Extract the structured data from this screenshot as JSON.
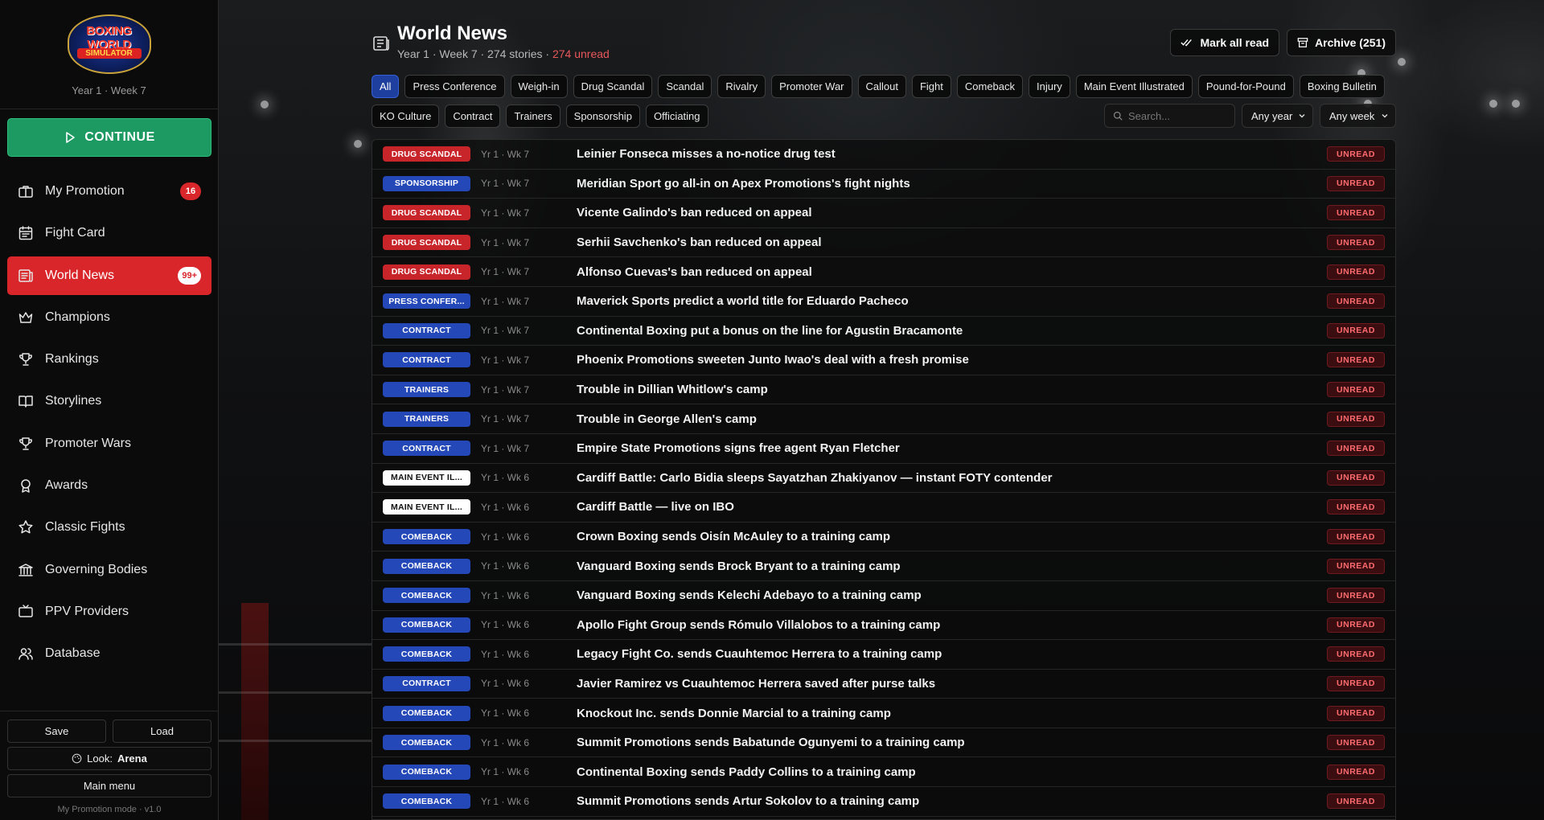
{
  "app": {
    "logo_line1": "BOXING WORLD",
    "logo_line2": "SIMULATOR",
    "period": "Year 1 · Week 7"
  },
  "sidebar": {
    "continue_label": "CONTINUE",
    "items": [
      {
        "label": "My Promotion",
        "icon": "briefcase-icon",
        "badge": "16",
        "active": false
      },
      {
        "label": "Fight Card",
        "icon": "calendar-icon",
        "badge": "",
        "active": false
      },
      {
        "label": "World News",
        "icon": "newspaper-icon",
        "badge": "99+",
        "active": true
      },
      {
        "label": "Champions",
        "icon": "crown-icon",
        "badge": "",
        "active": false
      },
      {
        "label": "Rankings",
        "icon": "trophy-icon",
        "badge": "",
        "active": false
      },
      {
        "label": "Storylines",
        "icon": "book-icon",
        "badge": "",
        "active": false
      },
      {
        "label": "Promoter Wars",
        "icon": "trophy-icon",
        "badge": "",
        "active": false
      },
      {
        "label": "Awards",
        "icon": "award-icon",
        "badge": "",
        "active": false
      },
      {
        "label": "Classic Fights",
        "icon": "star-icon",
        "badge": "",
        "active": false
      },
      {
        "label": "Governing Bodies",
        "icon": "bank-icon",
        "badge": "",
        "active": false
      },
      {
        "label": "PPV Providers",
        "icon": "tv-icon",
        "badge": "",
        "active": false
      },
      {
        "label": "Database",
        "icon": "users-icon",
        "badge": "",
        "active": false
      }
    ],
    "save_label": "Save",
    "load_label": "Load",
    "look_label": "Look:",
    "look_value": "Arena",
    "main_menu_label": "Main menu",
    "version": "My Promotion mode · v1.0"
  },
  "header": {
    "title": "World News",
    "subtitle_prefix": "Year 1 · Week 7 · 274 stories · ",
    "subtitle_unread": "274 unread",
    "mark_all_read": "Mark all read",
    "archive": "Archive (251)"
  },
  "filters": {
    "row1": [
      "All",
      "Press Conference",
      "Weigh-in",
      "Drug Scandal",
      "Scandal",
      "Rivalry",
      "Promoter War",
      "Callout",
      "Fight",
      "Comeback",
      "Injury",
      "Main Event Illustrated",
      "Pound-for-Pound",
      "Boxing Bulletin"
    ],
    "row2": [
      "KO Culture",
      "Contract",
      "Trainers",
      "Sponsorship",
      "Officiating"
    ],
    "active": "All",
    "search_placeholder": "Search...",
    "year_select": "Any year",
    "week_select": "Any week"
  },
  "tag_colors": {
    "DRUG SCANDAL": {
      "bg": "#c8252b",
      "fg": "#ffffff"
    },
    "SPONSORSHIP": {
      "bg": "#2448b8",
      "fg": "#ffffff"
    },
    "PRESS CONFER...": {
      "bg": "#2448b8",
      "fg": "#ffffff"
    },
    "CONTRACT": {
      "bg": "#2448b8",
      "fg": "#ffffff"
    },
    "TRAINERS": {
      "bg": "#2448b8",
      "fg": "#ffffff"
    },
    "COMEBACK": {
      "bg": "#2448b8",
      "fg": "#ffffff"
    },
    "MAIN EVENT IL...": {
      "bg": "#ffffff",
      "fg": "#111111"
    }
  },
  "news": [
    {
      "tag": "DRUG SCANDAL",
      "date": "Yr 1 · Wk 7",
      "headline": "Leinier Fonseca misses a no-notice drug test",
      "status": "UNREAD"
    },
    {
      "tag": "SPONSORSHIP",
      "date": "Yr 1 · Wk 7",
      "headline": "Meridian Sport go all-in on Apex Promotions's fight nights",
      "status": "UNREAD"
    },
    {
      "tag": "DRUG SCANDAL",
      "date": "Yr 1 · Wk 7",
      "headline": "Vicente Galindo's ban reduced on appeal",
      "status": "UNREAD"
    },
    {
      "tag": "DRUG SCANDAL",
      "date": "Yr 1 · Wk 7",
      "headline": "Serhii Savchenko's ban reduced on appeal",
      "status": "UNREAD"
    },
    {
      "tag": "DRUG SCANDAL",
      "date": "Yr 1 · Wk 7",
      "headline": "Alfonso Cuevas's ban reduced on appeal",
      "status": "UNREAD"
    },
    {
      "tag": "PRESS CONFER...",
      "date": "Yr 1 · Wk 7",
      "headline": "Maverick Sports predict a world title for Eduardo Pacheco",
      "status": "UNREAD"
    },
    {
      "tag": "CONTRACT",
      "date": "Yr 1 · Wk 7",
      "headline": "Continental Boxing put a bonus on the line for Agustin Bracamonte",
      "status": "UNREAD"
    },
    {
      "tag": "CONTRACT",
      "date": "Yr 1 · Wk 7",
      "headline": "Phoenix Promotions sweeten Junto Iwao's deal with a fresh promise",
      "status": "UNREAD"
    },
    {
      "tag": "TRAINERS",
      "date": "Yr 1 · Wk 7",
      "headline": "Trouble in Dillian Whitlow's camp",
      "status": "UNREAD"
    },
    {
      "tag": "TRAINERS",
      "date": "Yr 1 · Wk 7",
      "headline": "Trouble in George Allen's camp",
      "status": "UNREAD"
    },
    {
      "tag": "CONTRACT",
      "date": "Yr 1 · Wk 7",
      "headline": "Empire State Promotions signs free agent Ryan Fletcher",
      "status": "UNREAD"
    },
    {
      "tag": "MAIN EVENT IL...",
      "date": "Yr 1 · Wk 6",
      "headline": "Cardiff Battle: Carlo Bidia sleeps Sayatzhan Zhakiyanov — instant FOTY contender",
      "status": "UNREAD"
    },
    {
      "tag": "MAIN EVENT IL...",
      "date": "Yr 1 · Wk 6",
      "headline": "Cardiff Battle — live on IBO",
      "status": "UNREAD"
    },
    {
      "tag": "COMEBACK",
      "date": "Yr 1 · Wk 6",
      "headline": "Crown Boxing sends Oisín McAuley to a training camp",
      "status": "UNREAD"
    },
    {
      "tag": "COMEBACK",
      "date": "Yr 1 · Wk 6",
      "headline": "Vanguard Boxing sends Brock Bryant to a training camp",
      "status": "UNREAD"
    },
    {
      "tag": "COMEBACK",
      "date": "Yr 1 · Wk 6",
      "headline": "Vanguard Boxing sends Kelechi Adebayo to a training camp",
      "status": "UNREAD"
    },
    {
      "tag": "COMEBACK",
      "date": "Yr 1 · Wk 6",
      "headline": "Apollo Fight Group sends Rómulo Villalobos to a training camp",
      "status": "UNREAD"
    },
    {
      "tag": "COMEBACK",
      "date": "Yr 1 · Wk 6",
      "headline": "Legacy Fight Co. sends Cuauhtemoc Herrera to a training camp",
      "status": "UNREAD"
    },
    {
      "tag": "CONTRACT",
      "date": "Yr 1 · Wk 6",
      "headline": "Javier Ramirez vs Cuauhtemoc Herrera saved after purse talks",
      "status": "UNREAD"
    },
    {
      "tag": "COMEBACK",
      "date": "Yr 1 · Wk 6",
      "headline": "Knockout Inc. sends Donnie Marcial to a training camp",
      "status": "UNREAD"
    },
    {
      "tag": "COMEBACK",
      "date": "Yr 1 · Wk 6",
      "headline": "Summit Promotions sends Babatunde Ogunyemi to a training camp",
      "status": "UNREAD"
    },
    {
      "tag": "COMEBACK",
      "date": "Yr 1 · Wk 6",
      "headline": "Continental Boxing sends Paddy Collins to a training camp",
      "status": "UNREAD"
    },
    {
      "tag": "COMEBACK",
      "date": "Yr 1 · Wk 6",
      "headline": "Summit Promotions sends Artur Sokolov to a training camp",
      "status": "UNREAD"
    }
  ]
}
